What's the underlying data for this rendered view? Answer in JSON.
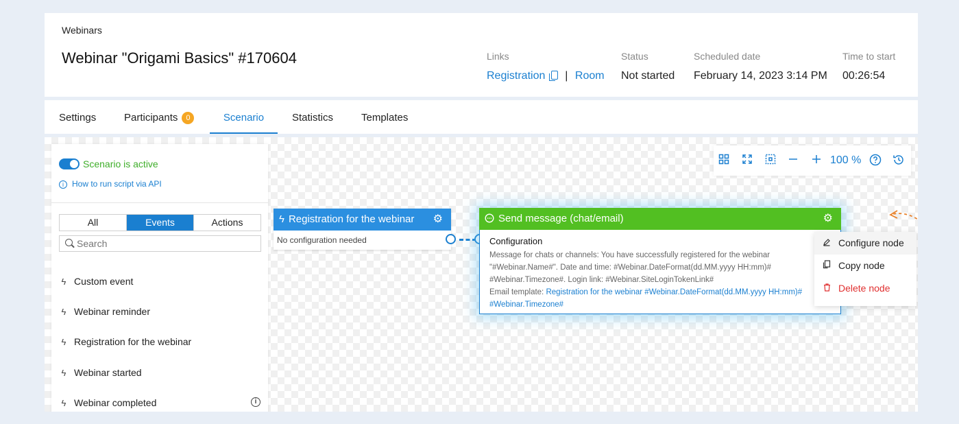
{
  "header": {
    "breadcrumb": "Webinars",
    "title": "Webinar \"Origami Basics\" #170604",
    "links_label": "Links",
    "registration_link": "Registration",
    "room_link": "Room",
    "separator": "|",
    "status_label": "Status",
    "status_value": "Not started",
    "scheduled_label": "Scheduled date",
    "scheduled_value": "February 14, 2023 3:14 PM",
    "time_label": "Time to start",
    "time_value": "00:26:54"
  },
  "tabs": [
    {
      "label": "Settings"
    },
    {
      "label": "Participants",
      "badge": "0"
    },
    {
      "label": "Scenario"
    },
    {
      "label": "Statistics"
    },
    {
      "label": "Templates"
    }
  ],
  "sidebar": {
    "toggle_label": "Scenario is active",
    "api_link": "How to run script via API",
    "filters": [
      "All",
      "Events",
      "Actions"
    ],
    "search_placeholder": "Search",
    "events": [
      "Custom event",
      "Webinar reminder",
      "Registration for the webinar",
      "Webinar started",
      "Webinar completed"
    ]
  },
  "toolbar": {
    "zoom": "100 %"
  },
  "nodes": {
    "registration": {
      "title": "Registration for the webinar",
      "subtitle": "No configuration needed"
    },
    "send_message": {
      "title": "Send message (chat/email)",
      "config_title": "Configuration",
      "message_line1": "Message for chats or channels: You have successfully registered for the webinar",
      "message_line2": "\"#Webinar.Name#\". Date and time: #Webinar.DateFormat(dd.MM.yyyy HH:mm)#",
      "message_line3": "#Webinar.Timezone#. Login link: #Webinar.SiteLoginTokenLink#",
      "email_label": "Email template:",
      "email_link1": "Registration for the webinar #Webinar.DateFormat(dd.MM.yyyy HH:mm)#",
      "email_link2": "#Webinar.Timezone#"
    }
  },
  "context_menu": {
    "configure": "Configure node",
    "copy": "Copy node",
    "delete": "Delete node"
  },
  "colors": {
    "accent": "#1a7fd0",
    "active_green": "#3fae2a",
    "node_green": "#52bf22",
    "badge": "#f5a623",
    "danger": "#e03030"
  }
}
